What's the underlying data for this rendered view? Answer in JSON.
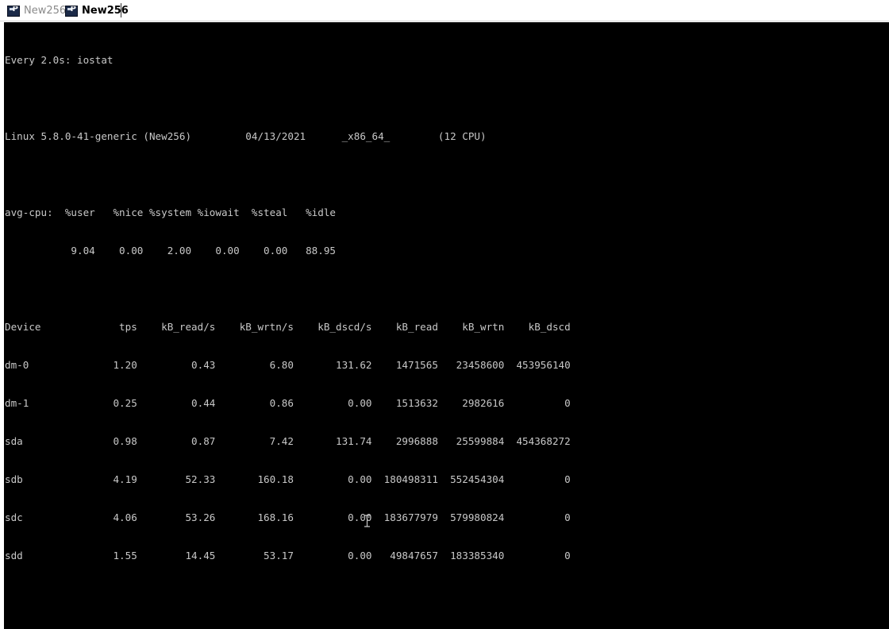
{
  "tabs": [
    {
      "label": "New256",
      "active": false
    },
    {
      "label": "New256",
      "active": true
    }
  ],
  "terminal": {
    "lines": [
      "Every 2.0s: iostat",
      "",
      "Linux 5.8.0-41-generic (New256)         04/13/2021      _x86_64_        (12 CPU)",
      "",
      "avg-cpu:  %user   %nice %system %iowait  %steal   %idle",
      "           9.04    0.00    2.00    0.00    0.00   88.95",
      "",
      "Device             tps    kB_read/s    kB_wrtn/s    kB_dscd/s    kB_read    kB_wrtn    kB_dscd",
      "dm-0              1.20         0.43         6.80       131.62    1471565   23458600  453956140",
      "dm-1              0.25         0.44         0.86         0.00    1513632    2982616          0",
      "sda               0.98         0.87         7.42       131.74    2996888   25599884  454368272",
      "sdb               4.19        52.33       160.18         0.00  180498311  552454304          0",
      "sdc               4.06        53.26       168.16         0.00  183677979  579980824          0",
      "sdd               1.55        14.45        53.17         0.00   49847657  183385340          0"
    ],
    "fg_color": "#c8c8c8",
    "bg_color": "#000000"
  },
  "cursor": {
    "icon": "text-ibeam-cursor-icon"
  }
}
